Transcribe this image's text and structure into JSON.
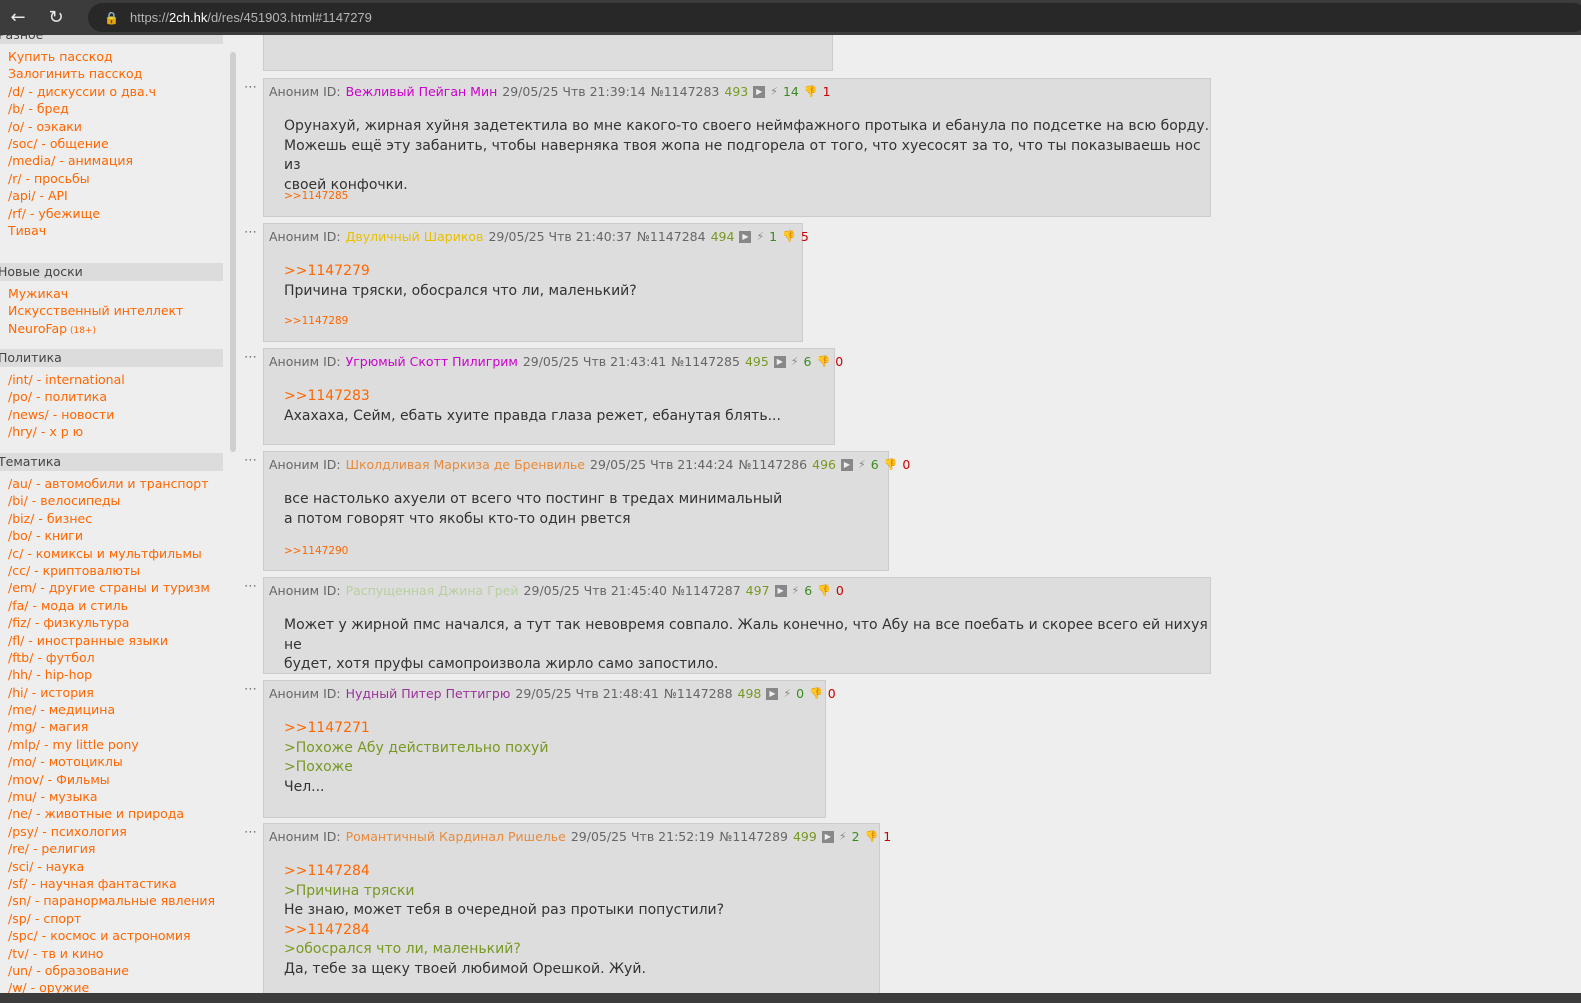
{
  "browser": {
    "url_prefix": "https://",
    "url_host": "2ch.hk",
    "url_path": "/d/res/451903.html#1147279"
  },
  "sidebar": {
    "sections": [
      {
        "title": "Разное",
        "items": [
          "Купить пасскод",
          "Залогинить пасскод",
          "/d/ - дискуссии о два.ч",
          "/b/ - бред",
          "/o/ - оэкаки",
          "/soc/ - общение",
          "/media/ - анимация",
          "/r/ - просьбы",
          "/api/ - API",
          "/rf/ - убежище",
          "Тивач"
        ]
      },
      {
        "title": "Новые доски",
        "items": [
          "Мужикач",
          "Искусственный интеллект",
          "NeuroFap"
        ],
        "tag": "(18+)"
      },
      {
        "title": "Политика",
        "items": [
          "/int/ - international",
          "/po/ - политика",
          "/news/ - новости",
          "/hry/ - х р ю"
        ]
      },
      {
        "title": "Тематика",
        "items": [
          "/au/ - автомобили и транспорт",
          "/bi/ - велосипеды",
          "/biz/ - бизнес",
          "/bo/ - книги",
          "/c/ - комиксы и мультфильмы",
          "/cc/ - криптовалюты",
          "/em/ - другие страны и туризм",
          "/fa/ - мода и стиль",
          "/fiz/ - физкультура",
          "/fl/ - иностранные языки",
          "/ftb/ - футбол",
          "/hh/ - hip-hop",
          "/hi/ - история",
          "/me/ - медицина",
          "/mg/ - магия",
          "/mlp/ - my little pony",
          "/mo/ - мотоциклы",
          "/mov/ - Фильмы",
          "/mu/ - музыка",
          "/ne/ - животные и природа",
          "/psy/ - психология",
          "/re/ - религия",
          "/sci/ - наука",
          "/sf/ - научная фантастика",
          "/sn/ - паранормальные явления",
          "/sp/ - спорт",
          "/spc/ - космос и астрономия",
          "/tv/ - тв и кино",
          "/un/ - образование",
          "/w/ - оружие"
        ]
      }
    ]
  },
  "posts": [
    {
      "anon": "Аноним ID:",
      "name": "Вежливый Пейган Мин",
      "name_color": "#cc00cc",
      "date": "29/05/25 Чтв 21:39:14",
      "num": "№1147283",
      "count": "493",
      "likes": "14",
      "dislikes": "1",
      "lines": [
        {
          "t": "Орунахуй, жирная хуйня задетектила во мне какого-то своего неймфажного протыка и ебанула по подсетке на всю борду.",
          "k": "text"
        },
        {
          "t": "Можешь ещё эту забанить, чтобы наверняка твоя жопа не подгорела от того, что хуесосят за то, что ты показываешь нос из",
          "k": "text"
        },
        {
          "t": "своей конфочки.",
          "k": "text"
        }
      ],
      "replies": ">>1147285"
    },
    {
      "anon": "Аноним ID:",
      "name": "Двуличный Шариков",
      "name_color": "#e8c000",
      "date": "29/05/25 Чтв 21:40:37",
      "num": "№1147284",
      "count": "494",
      "likes": "1",
      "dislikes": "5",
      "lines": [
        {
          "t": ">>1147279",
          "k": "reply"
        },
        {
          "t": "Причина тряски, обосрался что ли, маленький?",
          "k": "text"
        }
      ],
      "replies": ">>1147289"
    },
    {
      "anon": "Аноним ID:",
      "name": "Угрюмый Скотт Пилигрим",
      "name_color": "#cc00cc",
      "date": "29/05/25 Чтв 21:43:41",
      "num": "№1147285",
      "count": "495",
      "likes": "6",
      "dislikes": "0",
      "lines": [
        {
          "t": ">>1147283",
          "k": "reply"
        },
        {
          "t": "Ахахаха, Сейм, ебать хуите правда глаза режет, ебанутая блять...",
          "k": "text"
        }
      ],
      "replies": ""
    },
    {
      "anon": "Аноним ID:",
      "name": "Школдливая Маркиза де Бренвилье",
      "name_color": "#e88a3a",
      "date": "29/05/25 Чтв 21:44:24",
      "num": "№1147286",
      "count": "496",
      "likes": "6",
      "dislikes": "0",
      "lines": [
        {
          "t": "все настолько ахуели от всего что постинг в тредах минимальный",
          "k": "text"
        },
        {
          "t": "а потом говорят что якобы кто-то один рвется",
          "k": "text"
        }
      ],
      "replies": ">>1147290"
    },
    {
      "anon": "Аноним ID:",
      "name": "Распущенная Джина Грей",
      "name_color": "#b8d0a0",
      "date": "29/05/25 Чтв 21:45:40",
      "num": "№1147287",
      "count": "497",
      "likes": "6",
      "dislikes": "0",
      "lines": [
        {
          "t": "Может у жирной пмс начался, а тут так невовремя совпало. Жаль конечно, что Абу на все поебать и скорее всего ей нихуя не",
          "k": "text"
        },
        {
          "t": "будет, хотя пруфы самопроизвола жирло само запостило.",
          "k": "text"
        }
      ],
      "replies": ""
    },
    {
      "anon": "Аноним ID:",
      "name": "Нудный Питер Петтигрю",
      "name_color": "#993399",
      "date": "29/05/25 Чтв 21:48:41",
      "num": "№1147288",
      "count": "498",
      "likes": "0",
      "dislikes": "0",
      "lines": [
        {
          "t": ">>1147271",
          "k": "reply"
        },
        {
          "t": ">Похоже Абу действительно похуй",
          "k": "quote"
        },
        {
          "t": ">Похоже",
          "k": "quote"
        },
        {
          "t": "Чел...",
          "k": "text"
        }
      ],
      "replies": ""
    },
    {
      "anon": "Аноним ID:",
      "name": "Романтичный Кардинал Ришелье",
      "name_color": "#e88a3a",
      "date": "29/05/25 Чтв 21:52:19",
      "num": "№1147289",
      "count": "499",
      "likes": "2",
      "dislikes": "1",
      "lines": [
        {
          "t": ">>1147284",
          "k": "reply"
        },
        {
          "t": ">Причина тряски",
          "k": "quote"
        },
        {
          "t": "Не знаю, может тебя в очередной раз протыки попустили?",
          "k": "text"
        },
        {
          "t": ">>1147284",
          "k": "reply"
        },
        {
          "t": ">обосрался что ли, маленький?",
          "k": "quote"
        },
        {
          "t": "Да, тебе за щеку твоей любимой Орешкой. Жуй.",
          "k": "text"
        }
      ],
      "replies": ""
    }
  ],
  "dots": "⋯",
  "colors": {
    "link": "#ff6600",
    "quote": "#789922",
    "post_bg": "#dddddd",
    "page_bg": "#eeeeee"
  }
}
